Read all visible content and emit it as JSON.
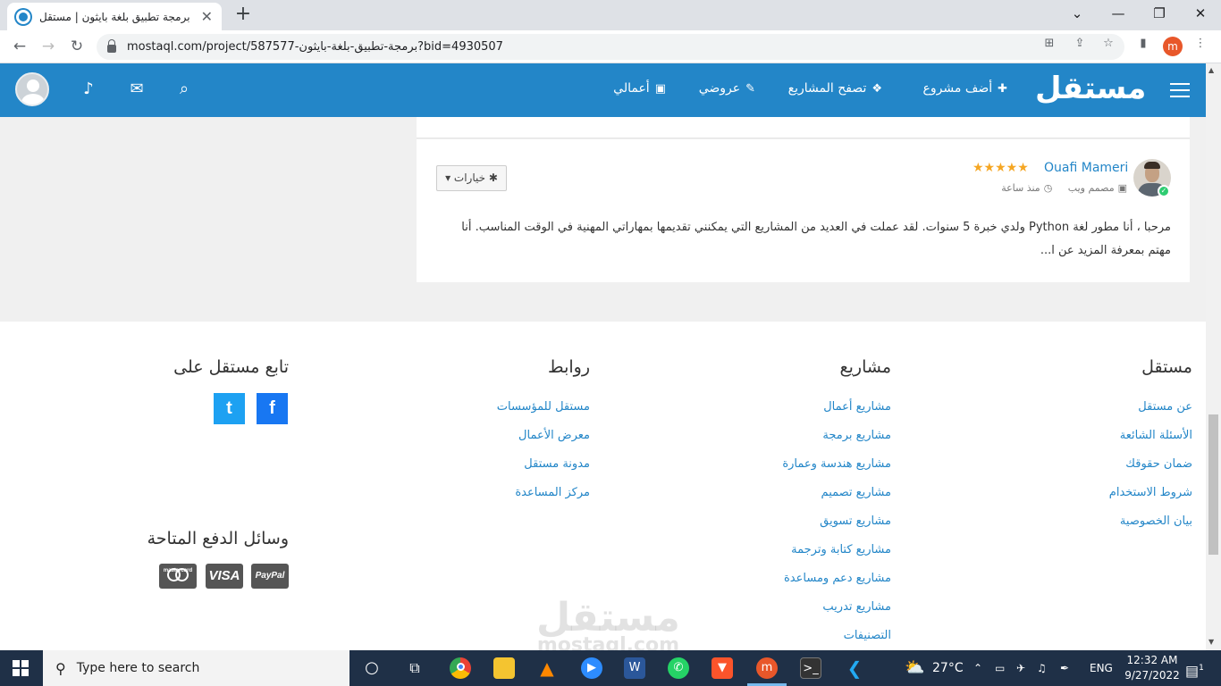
{
  "browser": {
    "tab_title": "برمجة تطبيق بلغة بايثون | مستقل",
    "url": "mostaql.com/project/587577-برمجة-تطبيق-بلغة-بايثون?bid=4930507",
    "profile_initial": "m"
  },
  "header": {
    "logo": "مستقل",
    "nav": [
      {
        "label": "أضف مشروع",
        "icon": "plus-icon"
      },
      {
        "label": "تصفح المشاريع",
        "icon": "cubes-icon"
      },
      {
        "label": "عروضي",
        "icon": "gavel-icon"
      },
      {
        "label": "أعمالي",
        "icon": "briefcase-icon"
      }
    ]
  },
  "bid": {
    "username": "Ouafi Mameri",
    "stars": "★★★★★",
    "role": "مصمم ويب",
    "time": "منذ ساعة",
    "options_label": "خيارات",
    "text": "مرحبا ، أنا مطور لغة Python ولدي خبرة 5 سنوات. لقد عملت في العديد من المشاريع التي يمكنني تقديمها بمهاراتي المهنية في الوقت المناسب. أنا مهتم بمعرفة المزيد عن ا..."
  },
  "footer": {
    "col_mostaql": {
      "title": "مستقل",
      "links": [
        "عن مستقل",
        "الأسئلة الشائعة",
        "ضمان حقوقك",
        "شروط الاستخدام",
        "بيان الخصوصية"
      ]
    },
    "col_projects": {
      "title": "مشاريع",
      "links": [
        "مشاريع أعمال",
        "مشاريع برمجة",
        "مشاريع هندسة وعمارة",
        "مشاريع تصميم",
        "مشاريع تسويق",
        "مشاريع كتابة وترجمة",
        "مشاريع دعم ومساعدة",
        "مشاريع تدريب",
        "التصنيفات"
      ]
    },
    "col_links": {
      "title": "روابط",
      "links": [
        "مستقل للمؤسسات",
        "معرض الأعمال",
        "مدونة مستقل",
        "مركز المساعدة"
      ]
    },
    "social_title": "تابع مستقل على",
    "social": [
      "f",
      "t"
    ],
    "payment_title": "وسائل الدفع المتاحة",
    "payment": [
      "PayPal",
      "VISA",
      "mastercard"
    ],
    "watermark": "مستقل",
    "watermark_sub": "mostaql.com"
  },
  "taskbar": {
    "search_placeholder": "Type here to search",
    "temperature": "27°C",
    "language": "ENG",
    "time": "12:32 AM",
    "date": "9/27/2022",
    "notification_count": "1"
  },
  "colors": {
    "brand": "#2386c8",
    "stars": "#f5a623",
    "facebook": "#1877f2",
    "twitter": "#1da1f2"
  }
}
